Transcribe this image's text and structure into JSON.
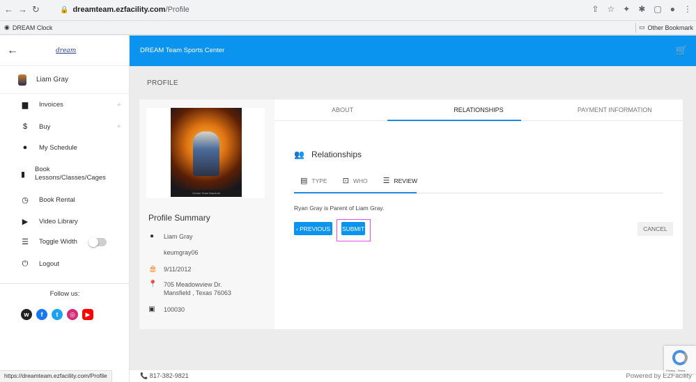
{
  "browser": {
    "url_host": "dreamteam.ezfacility.com",
    "url_path": "/Profile",
    "bookmark_left": "DREAM Clock",
    "bookmark_right": "Other Bookmark",
    "status_url": "https://dreamteam.ezfacility.com/Profile"
  },
  "sidebar": {
    "logo_text": "dream",
    "user_name": "Liam Gray",
    "items": [
      {
        "label": "Invoices"
      },
      {
        "label": "Buy"
      },
      {
        "label": "My Schedule"
      },
      {
        "label": "Book Lessons/Classes/Cages"
      },
      {
        "label": "Book Rental"
      },
      {
        "label": "Video Library"
      },
      {
        "label": "Toggle Width"
      },
      {
        "label": "Logout"
      }
    ],
    "follow_label": "Follow us:"
  },
  "topbar": {
    "title": "DREAM Team Sports Center"
  },
  "page": {
    "label": "PROFILE"
  },
  "profile": {
    "photo_caption": "Dream Team Baseball",
    "summary_title": "Profile Summary",
    "name": "Liam Gray",
    "username": "keumgray06",
    "birthday": "9/11/2012",
    "address_line1": "705 Meadowview Dr.",
    "address_line2": "Mansfield , Texas 76063",
    "member_id": "100030"
  },
  "tabs": [
    "ABOUT",
    "RELATIONSHIPS",
    "PAYMENT INFORMATION"
  ],
  "relationships": {
    "heading": "Relationships",
    "steps": [
      "TYPE",
      "WHO",
      "REVIEW"
    ],
    "summary": "Ryan Gray is Parent of Liam Gray.",
    "prev_label": "‹ PREVIOUS",
    "submit_label": "SUBMIT",
    "cancel_label": "CANCEL"
  },
  "footer": {
    "phone": "817-382-9821",
    "powered": "Powered by EZFacility"
  },
  "recaptcha_text": "Privacy - Terms",
  "colors": {
    "primary": "#0b93f0",
    "tab_indicator": "#1e88e5",
    "highlight": "#e94be9"
  }
}
